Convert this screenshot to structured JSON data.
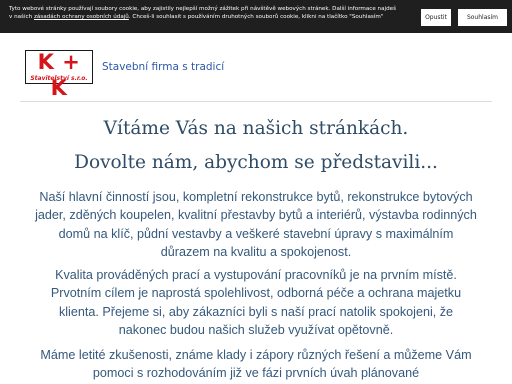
{
  "cookie_bar": {
    "text": "Tyto webové stránky používají soubory cookie, aby zajistily nejlepší možný zážitek při návštěvě webových stránek. Další informace najdeš v našich ",
    "link": "zásadách ochrany osobních údajů",
    "text_after": ". Chceš-li souhlasit s používáním druhotných souborů cookie, klikni na tlačítko \"Souhlasím\"",
    "reject_label": "Opustit",
    "accept_label": "Souhlasím"
  },
  "header": {
    "logo_main": "K + K",
    "logo_sub": "Stavitelství s.r.o.",
    "tagline": "Stavební firma s tradicí"
  },
  "main": {
    "welcome": "Vítáme Vás na našich stránkách.",
    "intro": "Dovolte nám, abychom se představili...",
    "paragraphs": [
      "Naší hlavní činností jsou, kompletní rekonstrukce bytů, rekonstrukce bytových jader, zděných koupelen, kvalitní přestavby bytů a interiérů, výstavba rodinných domů na klíč, půdní vestavby a veškeré stavební úpravy s maximálním důrazem na kvalitu a spokojenost.",
      "Kvalita prováděných prací a vystupování pracovníků je na prvním místě. Prvotním cílem je naprostá spolehlivost, odborná péče a ochrana majetku klienta. Přejeme si, aby zákazníci byli s naší prací natolik spokojeni, že nakonec budou našich služeb využívat opětovně.",
      "Máme letité zkušenosti, známe klady i zápory různých řešení a můžeme Vám pomoci s rozhodováním již ve fázi prvních úvah plánované"
    ]
  },
  "colors": {
    "cookie_bg": "#1f1f1f",
    "logo_red": "#d4151b",
    "tagline_blue": "#2c58a8",
    "body_text": "#35597c"
  }
}
